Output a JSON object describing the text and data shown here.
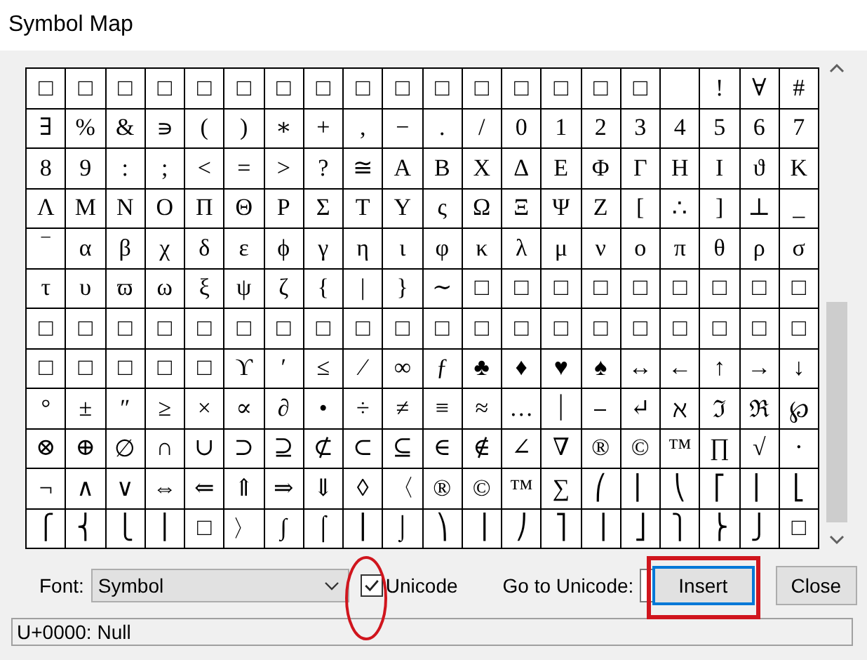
{
  "window": {
    "title": "Symbol Map"
  },
  "grid": {
    "rows": [
      [
        "□",
        "□",
        "□",
        "□",
        "□",
        "□",
        "□",
        "□",
        "□",
        "□",
        "□",
        "□",
        "□",
        "□",
        "□",
        "□",
        null,
        "!",
        "∀",
        "#"
      ],
      [
        "∃",
        "%",
        "&",
        "∍",
        "(",
        ")",
        "∗",
        "+",
        ",",
        "−",
        ".",
        "/",
        "0",
        "1",
        "2",
        "3",
        "4",
        "5",
        "6",
        "7"
      ],
      [
        "8",
        "9",
        ":",
        ";",
        "<",
        "=",
        ">",
        "?",
        "≅",
        "Α",
        "Β",
        "Χ",
        "Δ",
        "Ε",
        "Φ",
        "Γ",
        "Η",
        "Ι",
        "ϑ",
        "Κ"
      ],
      [
        "Λ",
        "Μ",
        "Ν",
        "Ο",
        "Π",
        "Θ",
        "Ρ",
        "Σ",
        "Τ",
        "Υ",
        "ς",
        "Ω",
        "Ξ",
        "Ψ",
        "Ζ",
        "[",
        "∴",
        "]",
        "⊥",
        "_"
      ],
      [
        "‾",
        "α",
        "β",
        "χ",
        "δ",
        "ε",
        "ϕ",
        "γ",
        "η",
        "ι",
        "φ",
        "κ",
        "λ",
        "μ",
        "ν",
        "ο",
        "π",
        "θ",
        "ρ",
        "σ"
      ],
      [
        "τ",
        "υ",
        "ϖ",
        "ω",
        "ξ",
        "ψ",
        "ζ",
        "{",
        "|",
        "}",
        "∼",
        "□",
        "□",
        "□",
        "□",
        "□",
        "□",
        "□",
        "□",
        "□"
      ],
      [
        "□",
        "□",
        "□",
        "□",
        "□",
        "□",
        "□",
        "□",
        "□",
        "□",
        "□",
        "□",
        "□",
        "□",
        "□",
        "□",
        "□",
        "□",
        "□",
        "□"
      ],
      [
        "□",
        "□",
        "□",
        "□",
        "□",
        "ϒ",
        "′",
        "≤",
        "⁄",
        "∞",
        "ƒ",
        "♣",
        "♦",
        "♥",
        "♠",
        "↔",
        "←",
        "↑",
        "→",
        "↓"
      ],
      [
        "°",
        "±",
        "″",
        "≥",
        "×",
        "∝",
        "∂",
        "•",
        "÷",
        "≠",
        "≡",
        "≈",
        "…",
        "⏐",
        "⎯",
        "↵",
        "ℵ",
        "ℑ",
        "ℜ",
        "℘"
      ],
      [
        "⊗",
        "⊕",
        "∅",
        "∩",
        "∪",
        "⊃",
        "⊇",
        "⊄",
        "⊂",
        "⊆",
        "∈",
        "∉",
        "∠",
        "∇",
        "®",
        "©",
        "™",
        "∏",
        "√",
        "⋅"
      ],
      [
        "¬",
        "∧",
        "∨",
        "⇔",
        "⇐",
        "⇑",
        "⇒",
        "⇓",
        "◊",
        "〈",
        "®",
        "©",
        "™",
        "∑",
        "⎛",
        "⎜",
        "⎝",
        "⎡",
        "⎢",
        "⎣"
      ],
      [
        "⎧",
        "⎨",
        "⎩",
        "⎪",
        "□",
        "〉",
        "∫",
        "⌠",
        "⎮",
        "⌡",
        "⎞",
        "⎟",
        "⎠",
        "⎤",
        "⎥",
        "⎦",
        "⎫",
        "⎬",
        "⎭",
        "□"
      ]
    ]
  },
  "font": {
    "label": "Font:",
    "value": "Symbol"
  },
  "unicode_checkbox": {
    "label": "Unicode",
    "checked": true
  },
  "goto": {
    "label": "Go to Unicode:"
  },
  "buttons": [
    {
      "label": "Insert",
      "default": true
    },
    {
      "label": "Close",
      "default": false
    }
  ],
  "status_bar": "U+0000: Null"
}
